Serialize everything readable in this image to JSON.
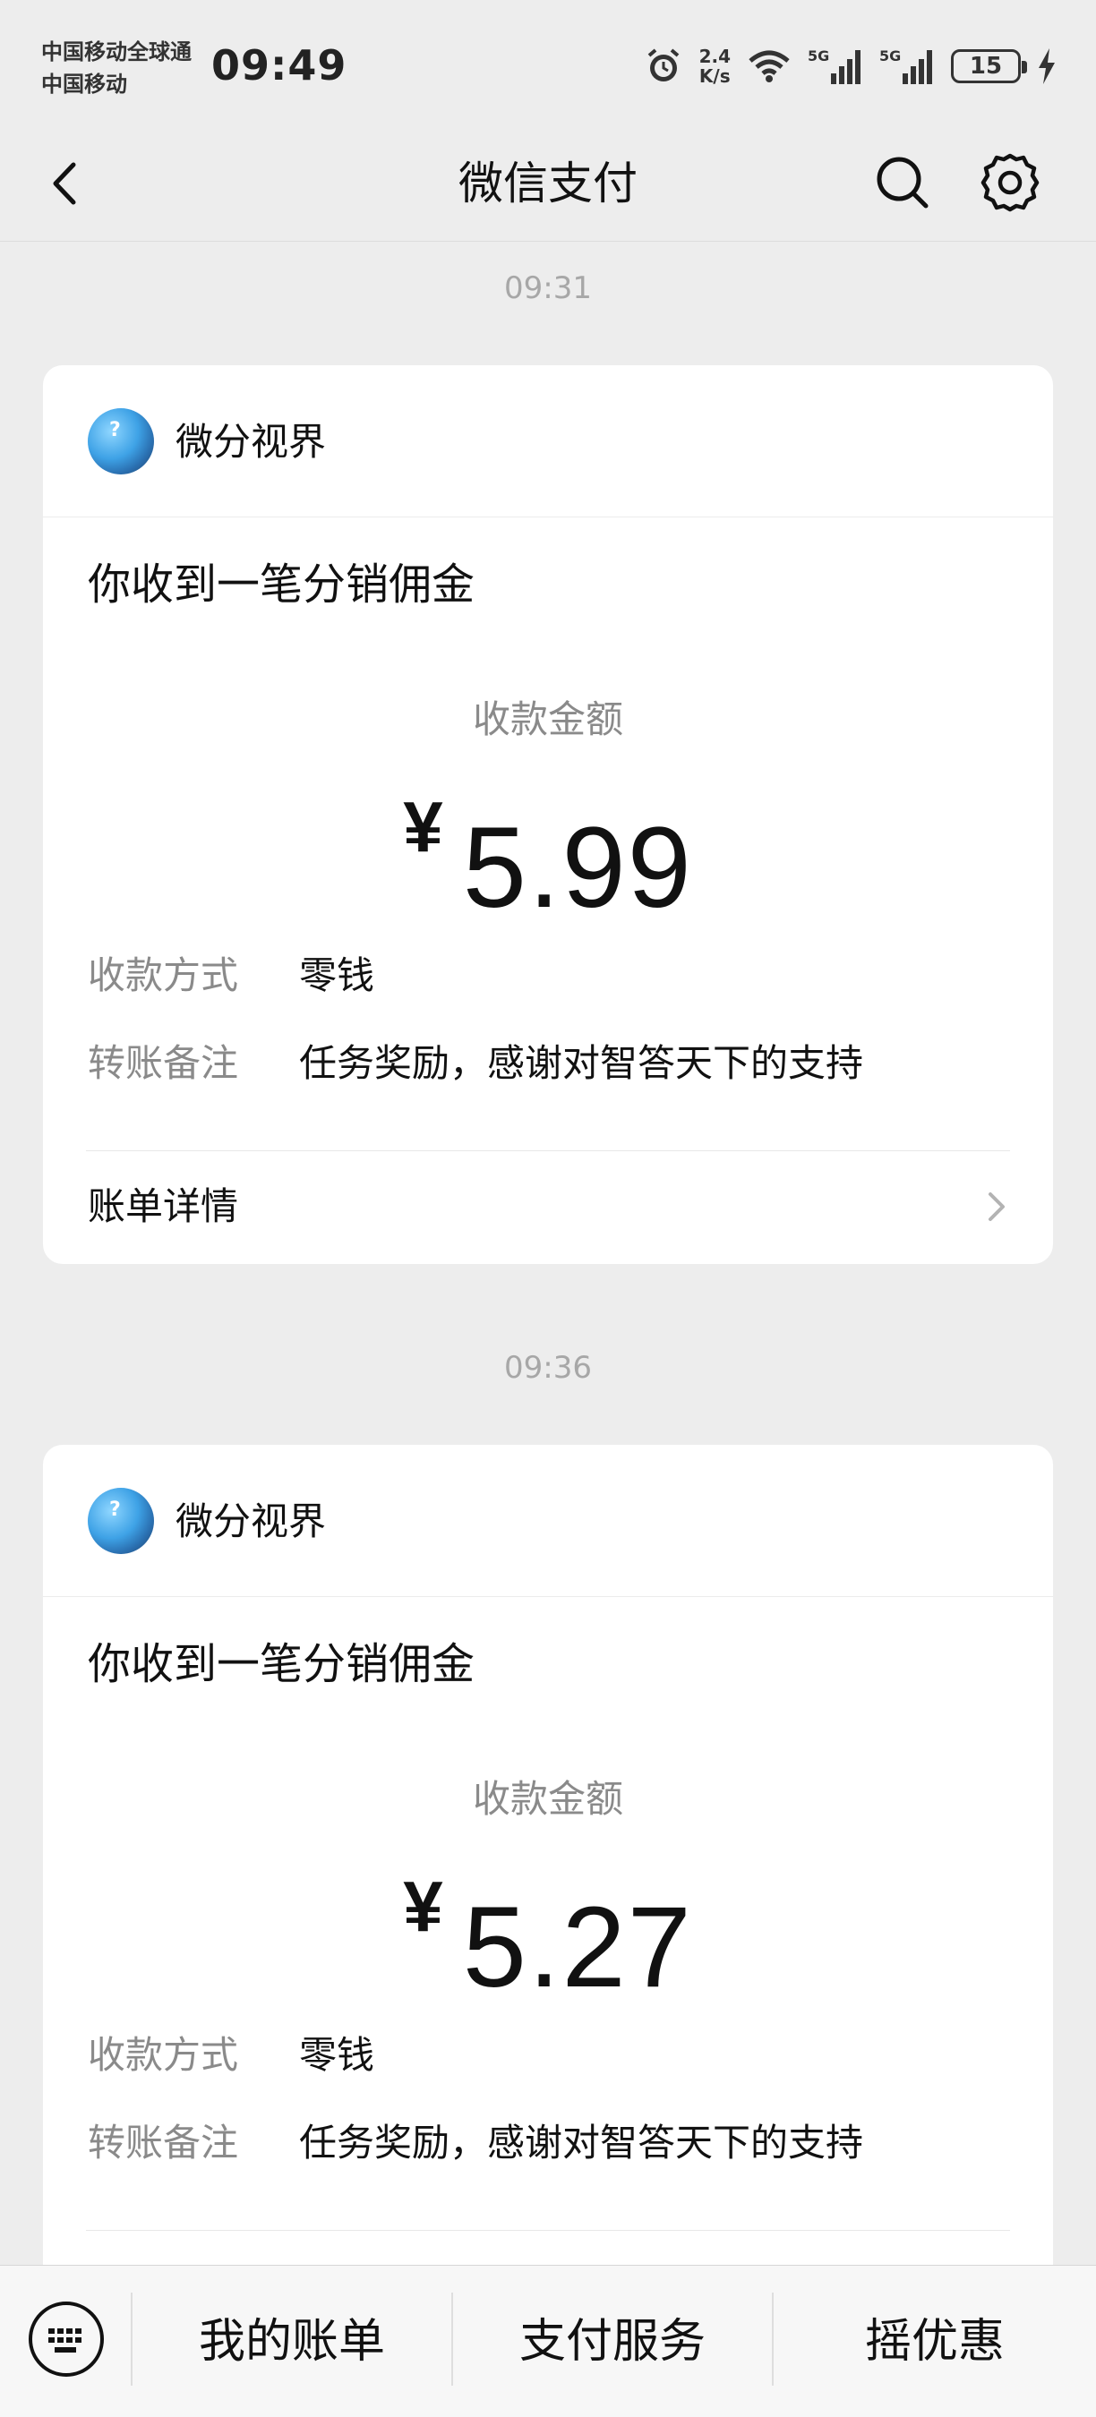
{
  "status_bar": {
    "carrier_line1": "中国移动全球通",
    "carrier_line2": "中国移动",
    "time": "09:49",
    "net_speed_top": "2.4",
    "net_speed_bottom": "K/s",
    "battery": "15",
    "icons": [
      "alarm-icon",
      "wifi-icon",
      "5g-signal-icon",
      "5g-signal-icon",
      "battery-icon",
      "charging-icon"
    ]
  },
  "nav": {
    "title": "微信支付",
    "icons": [
      "back-icon",
      "search-icon",
      "settings-icon"
    ]
  },
  "messages": [
    {
      "time": "09:31",
      "sender": "微分视界",
      "title": "你收到一笔分销佣金",
      "amount_label": "收款金额",
      "currency": "¥",
      "amount": "5.99",
      "method_label": "收款方式",
      "method_value": "零钱",
      "note_label": "转账备注",
      "note_value": "任务奖励，感谢对智答天下的支持",
      "detail_label": "账单详情"
    },
    {
      "time": "09:36",
      "sender": "微分视界",
      "title": "你收到一笔分销佣金",
      "amount_label": "收款金额",
      "currency": "¥",
      "amount": "5.27",
      "method_label": "收款方式",
      "method_value": "零钱",
      "note_label": "转账备注",
      "note_value": "任务奖励，感谢对智答天下的支持"
    }
  ],
  "bottom_bar": {
    "items": [
      "我的账单",
      "支付服务",
      "摇优惠"
    ]
  }
}
